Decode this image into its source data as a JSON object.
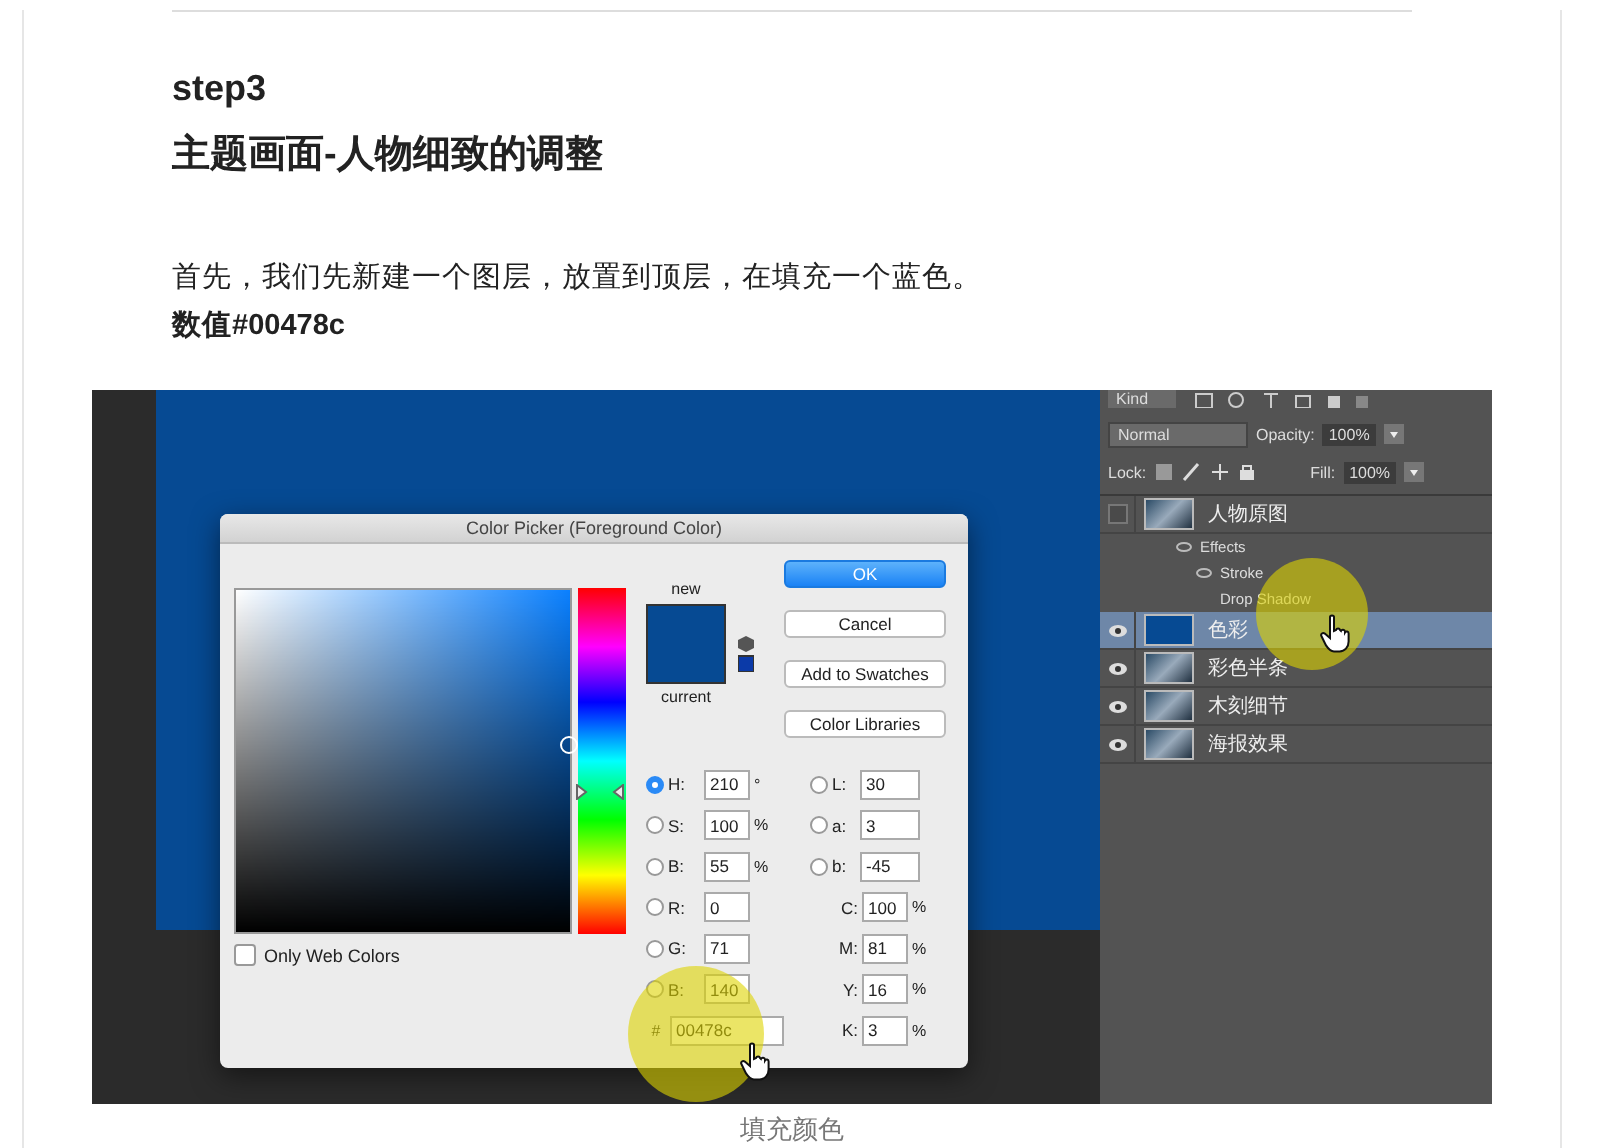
{
  "article": {
    "step": "step3",
    "heading": "主题画面-人物细致的调整",
    "paragraph": "首先，我们先新建一个图层，放置到顶层，在填充一个蓝色。",
    "value_note": "数值#00478c"
  },
  "screenshot": {
    "color_picker": {
      "title": "Color Picker (Foreground Color)",
      "new_label": "new",
      "current_label": "current",
      "buttons": [
        {
          "label": "OK",
          "default": true
        },
        {
          "label": "Cancel",
          "default": false
        },
        {
          "label": "Add to Swatches",
          "default": false
        },
        {
          "label": "Color Libraries",
          "default": false
        }
      ],
      "hue_slider": {
        "level": 0.41
      },
      "web_colors": {
        "label": "Only Web Colors",
        "checked": false
      },
      "hsb_rgb": [
        {
          "label": "H:",
          "value": "210",
          "unit": "°",
          "selected": true
        },
        {
          "label": "S:",
          "value": "100",
          "unit": "%",
          "selected": false
        },
        {
          "label": "B:",
          "value": "55",
          "unit": "%",
          "selected": false
        },
        {
          "label": "R:",
          "value": "0",
          "selected": false
        },
        {
          "label": "G:",
          "value": "71",
          "selected": false
        },
        {
          "label": "B:",
          "value": "140",
          "selected": false
        }
      ],
      "lab": [
        {
          "label": "L:",
          "value": "30",
          "selected": false
        },
        {
          "label": "a:",
          "value": "3",
          "selected": false
        },
        {
          "label": "b:",
          "value": "-45",
          "selected": false
        }
      ],
      "cmyk": [
        {
          "label": "C:",
          "value": "100",
          "unit": "%"
        },
        {
          "label": "M:",
          "value": "81",
          "unit": "%"
        },
        {
          "label": "Y:",
          "value": "16",
          "unit": "%"
        },
        {
          "label": "K:",
          "value": "3",
          "unit": "%"
        }
      ],
      "hex": {
        "label": "#",
        "value": "00478c"
      }
    },
    "layers_panel": {
      "filter": "Kind",
      "blend_mode": "Normal",
      "opacity_label": "Opacity:",
      "opacity": "100%",
      "lock_label": "Lock:",
      "fill_label": "Fill:",
      "fill": "100%",
      "layers": [
        {
          "name": "人物原图",
          "kind": "photo",
          "visible": false,
          "selected": false,
          "children": [
            {
              "name": "Effects",
              "visible": true,
              "children": [
                {
                  "name": "Stroke",
                  "visible": true
                },
                {
                  "name": "Drop Shadow",
                  "visible": false
                }
              ]
            }
          ]
        },
        {
          "name": "色彩",
          "kind": "fill",
          "visible": true,
          "selected": true
        },
        {
          "name": "彩色半条",
          "kind": "photo",
          "visible": true,
          "selected": false
        },
        {
          "name": "木刻细节",
          "kind": "photo",
          "visible": true,
          "selected": false
        },
        {
          "name": "海报效果",
          "kind": "photo",
          "visible": true,
          "selected": false
        }
      ]
    }
  },
  "caption": "填充颜色"
}
